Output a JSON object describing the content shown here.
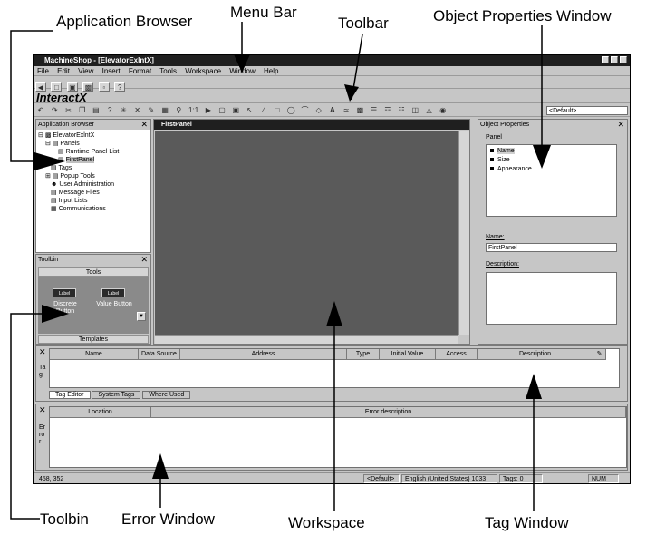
{
  "callouts": {
    "app_browser": "Application Browser",
    "menu_bar": "Menu Bar",
    "toolbar": "Toolbar",
    "object_props": "Object Properties Window",
    "toolbin": "Toolbin",
    "error_window": "Error Window",
    "workspace": "Workspace",
    "tag_window": "Tag Window"
  },
  "app": {
    "title": "MachineShop - [ElevatorExlntX]",
    "logo": "InteractX",
    "menu": [
      "File",
      "Edit",
      "View",
      "Insert",
      "Format",
      "Tools",
      "Workspace",
      "Window",
      "Help"
    ],
    "style_select": "<Default>"
  },
  "app_browser": {
    "title": "Application Browser",
    "items": [
      "ElevatorExlntX",
      "Panels",
      "Runtime Panel List",
      "FirstPanel",
      "Tags",
      "Popup Tools",
      "User Administration",
      "Message Files",
      "Input Lists",
      "Communications"
    ]
  },
  "toolbin": {
    "title": "Toolbin",
    "header": "Tools",
    "btn1_face": "Label",
    "btn1_caption": "Discrete Button",
    "btn2_face": "Label",
    "btn2_caption": "Value Button",
    "footer": "Templates"
  },
  "workspace": {
    "title": "FirstPanel"
  },
  "object_props": {
    "title": "Object Properties",
    "panel_label": "Panel",
    "items": [
      "Name",
      "Size",
      "Appearance"
    ],
    "name_label": "Name:",
    "name_value": "FirstPanel",
    "description_label": "Description:"
  },
  "tag_window": {
    "side_label": "Tag",
    "columns": [
      "Name",
      "Data Source",
      "Address",
      "Type",
      "Initial Value",
      "Access",
      "Description"
    ],
    "tabs": [
      "Tag Editor",
      "System Tags",
      "Where Used"
    ]
  },
  "error_window": {
    "side_label": "Error",
    "columns": [
      "Location",
      "Error description"
    ]
  },
  "status": {
    "coords": "458, 352",
    "style": "<Default>",
    "language": "English (United States) 1033",
    "tags": "Tags: 0",
    "num": "NUM"
  }
}
